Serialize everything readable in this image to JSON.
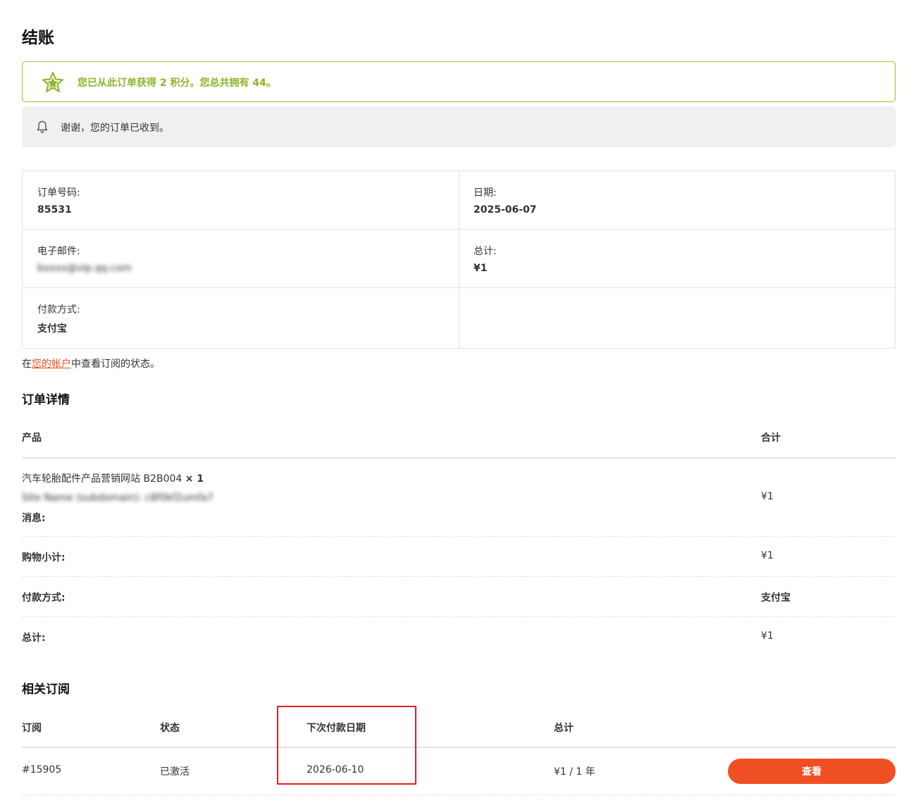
{
  "page": {
    "title": "结账"
  },
  "notices": {
    "points": "您已从此订单获得 2 积分。您总共拥有 44。",
    "thanks": "谢谢，您的订单已收到。"
  },
  "overview": {
    "order_number_label": "订单号码:",
    "order_number": "85531",
    "date_label": "日期:",
    "date": "2025-06-07",
    "email_label": "电子邮件:",
    "email": "bxxxx@vip.qq.com",
    "total_label": "总计:",
    "total": "¥1",
    "payment_label": "付款方式:",
    "payment": "支付宝"
  },
  "account_note": {
    "prefix": "在",
    "link": "您的帐户",
    "suffix": "中查看订阅的状态。"
  },
  "order_details": {
    "title": "订单详情",
    "col_product": "产品",
    "col_total": "合计",
    "product_name": "汽车轮胎配件产品营销网站 B2B004",
    "product_qty": "× 1",
    "site_name_meta": "Site Name (subdomain): c8f0kf2umfa7",
    "message_label": "消息:",
    "product_total": "¥1",
    "subtotal_label": "购物小计:",
    "subtotal": "¥1",
    "payment_label": "付款方式:",
    "payment": "支付宝",
    "total_label": "总计:",
    "total": "¥1"
  },
  "subscriptions": {
    "title": "相关订阅",
    "col_subscription": "订阅",
    "col_status": "状态",
    "col_next_payment": "下次付款日期",
    "col_total": "总计",
    "id": "#15905",
    "status": "已激活",
    "next_payment": "2026-06-10",
    "amount": "¥1 / 1 年",
    "view_button": "查看"
  },
  "colors": {
    "accent": "#f04f23",
    "points_green": "#8fb52a",
    "highlight_red": "#e0201f"
  }
}
